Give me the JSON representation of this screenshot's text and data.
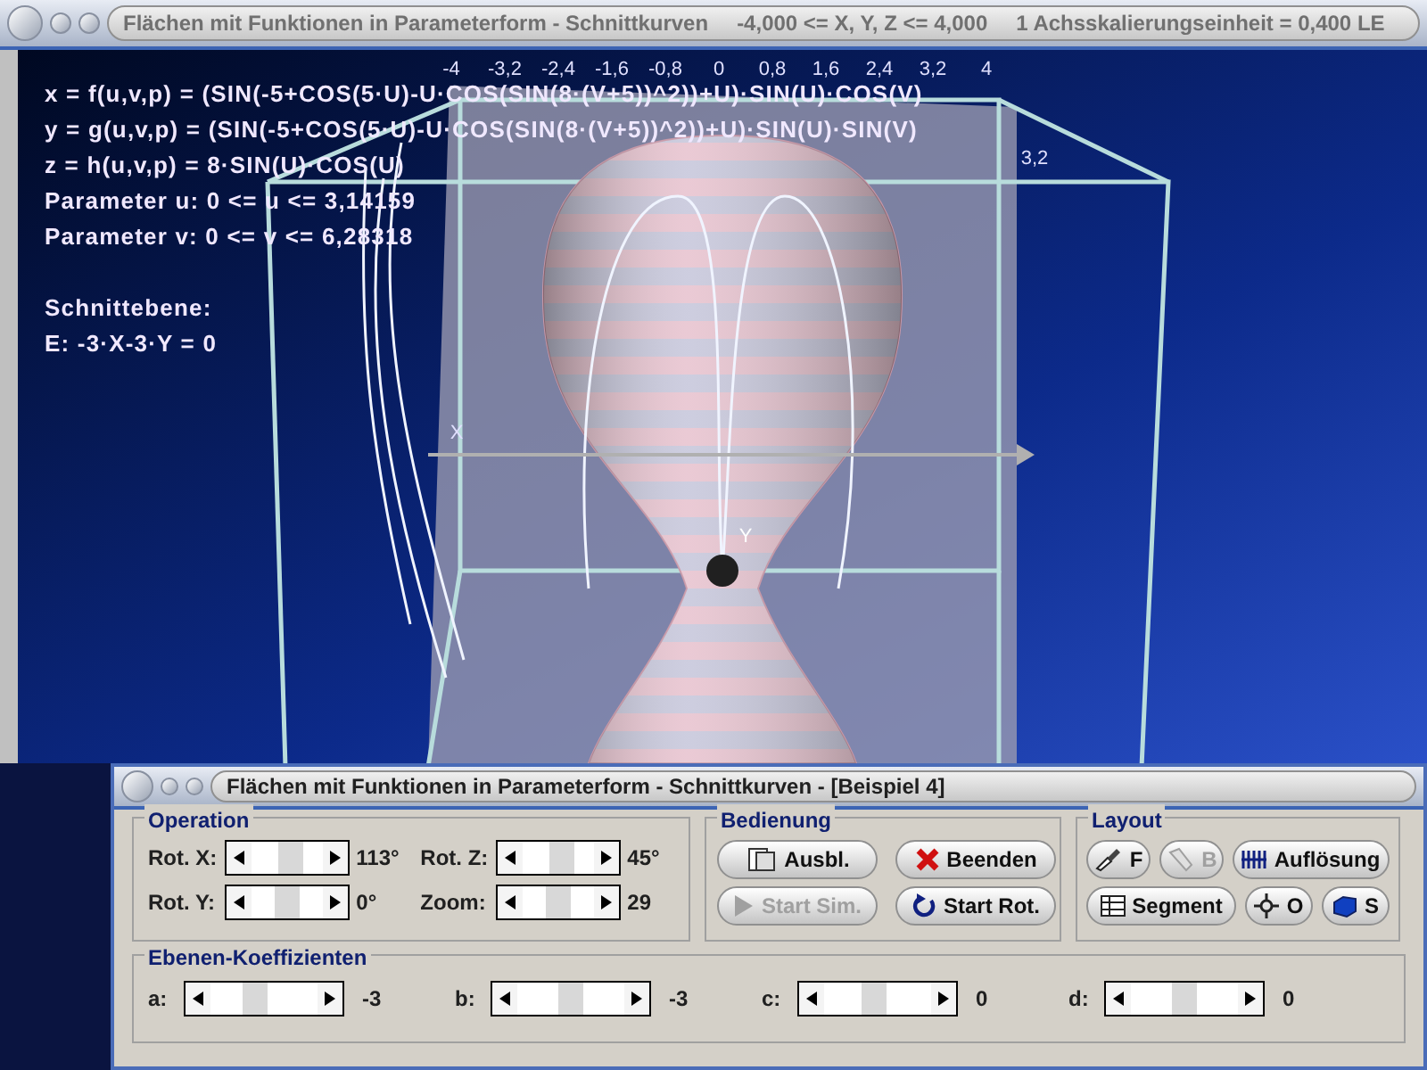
{
  "window": {
    "title": "Flächen mit Funktionen in Parameterform - Schnittkurven",
    "range": "-4,000 <= X, Y, Z <= 4,000",
    "scale": "1 Achsskalierungseinheit = 0,400 LE"
  },
  "scene": {
    "formula_lines": [
      "x = f(u,v,p) = (SIN(-5+COS(5·U)-U·COS(SIN(8·(V+5))^2))+U)·SIN(U)·COS(V)",
      "y = g(u,v,p) = (SIN(-5+COS(5·U)-U·COS(SIN(8·(V+5))^2))+U)·SIN(U)·SIN(V)",
      "z = h(u,v,p) = 8·SIN(U)·COS(U)",
      "Parameter u: 0 <= u <= 3,14159",
      "Parameter v: 0 <= v <= 6,28318"
    ],
    "section_heading": "Schnittebene:",
    "plane_equation": "E: -3·X-3·Y = 0",
    "axis_ticks": [
      "-4",
      "-3,2",
      "-2,4",
      "-1,6",
      "-0,8",
      "0",
      "0,8",
      "1,6",
      "2,4",
      "3,2",
      "4"
    ],
    "side_tick": "3,2",
    "axis_labels": [
      "X",
      "Y"
    ]
  },
  "panel": {
    "title": "Flächen mit Funktionen in Parameterform - Schnittkurven - [Beispiel 4]",
    "operation": {
      "title": "Operation",
      "sliders": [
        {
          "label": "Rot. X:",
          "level": 0.6,
          "reading": "113°"
        },
        {
          "label": "Rot. Z:",
          "level": 0.6,
          "reading": "45°"
        },
        {
          "label": "Rot. Y:",
          "level": 0.5,
          "reading": "0°"
        },
        {
          "label": "Zoom:",
          "level": 0.5,
          "reading": "29"
        }
      ]
    },
    "bedienung": {
      "title": "Bedienung",
      "buttons": [
        {
          "label": "Ausbl.",
          "kind": "hide",
          "disabled": false
        },
        {
          "label": "Beenden",
          "kind": "quit",
          "disabled": false
        },
        {
          "label": "Start Sim.",
          "kind": "play",
          "disabled": true
        },
        {
          "label": "Start Rot.",
          "kind": "rotate",
          "disabled": false
        }
      ]
    },
    "layout": {
      "title": "Layout",
      "buttons": [
        {
          "label": "F",
          "kind": "brush",
          "disabled": false
        },
        {
          "label": "B",
          "kind": "flashlight",
          "disabled": true
        },
        {
          "label": "Auflösung",
          "kind": "lines",
          "disabled": false
        },
        {
          "label": "Segment",
          "kind": "table",
          "disabled": false
        },
        {
          "label": "O",
          "kind": "crosshair",
          "disabled": false
        },
        {
          "label": "S",
          "kind": "cube",
          "disabled": false
        }
      ]
    },
    "coefficients": {
      "title": "Ebenen-Koeffizienten",
      "sliders": [
        {
          "label": "a:",
          "level": 0.4,
          "reading": "-3"
        },
        {
          "label": "b:",
          "level": 0.5,
          "reading": "-3"
        },
        {
          "label": "c:",
          "level": 0.45,
          "reading": "0"
        },
        {
          "label": "d:",
          "level": 0.5,
          "reading": "0"
        }
      ]
    }
  }
}
